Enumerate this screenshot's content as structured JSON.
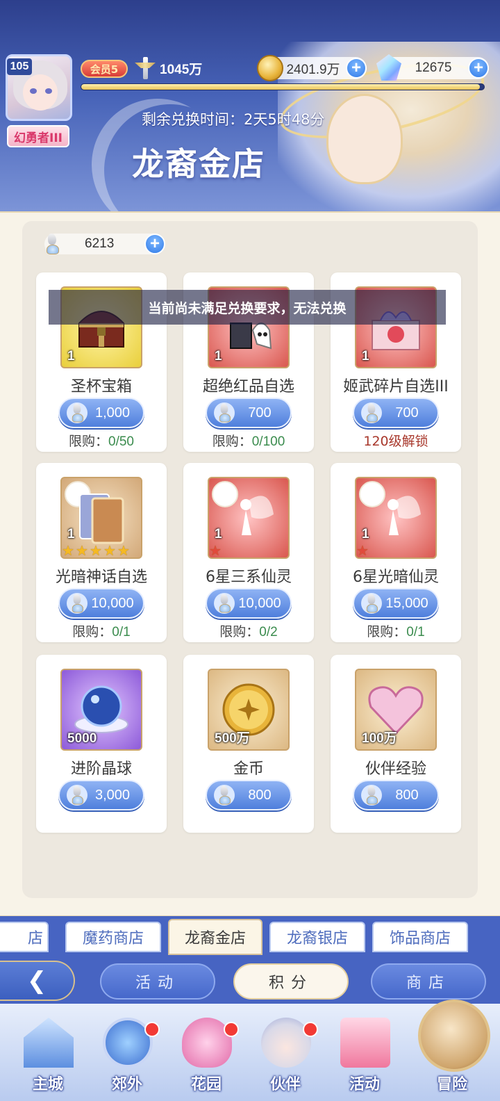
{
  "header": {
    "level": "105",
    "player_title": "幻勇者III",
    "vip": "会员5",
    "power": "1045万",
    "gold": "2401.9万",
    "gems": "12675",
    "exp_fraction": 0.99,
    "countdown": "剩余兑换时间：2天5时48分",
    "shop_title": "龙裔金店"
  },
  "currency": {
    "amount": "6213"
  },
  "toast": "当前尚未满足兑换要求，无法兑换",
  "items": [
    {
      "name": "圣杯宝箱",
      "qty": "1",
      "price": "1,000",
      "limit_label": "限购：",
      "limit_value": "0/50"
    },
    {
      "name": "超绝红品自选",
      "qty": "1",
      "price": "700",
      "limit_label": "限购：",
      "limit_value": "0/100"
    },
    {
      "name": "姬武碎片自选III",
      "qty": "1",
      "price": "700",
      "lock_text": "120级解锁"
    },
    {
      "name": "光暗神话自选",
      "qty": "1",
      "price": "10,000",
      "limit_label": "限购：",
      "limit_value": "0/1",
      "stars": 5
    },
    {
      "name": "6星三系仙灵",
      "qty": "1",
      "price": "10,000",
      "limit_label": "限购：",
      "limit_value": "0/2",
      "stars": 1
    },
    {
      "name": "6星光暗仙灵",
      "qty": "1",
      "price": "15,000",
      "limit_label": "限购：",
      "limit_value": "0/1",
      "stars": 1
    },
    {
      "name": "进阶晶球",
      "qty": "5000",
      "price": "3,000"
    },
    {
      "name": "金币",
      "qty": "500万",
      "price": "800"
    },
    {
      "name": "伙伴经验",
      "qty": "100万",
      "price": "800"
    }
  ],
  "shop_tabs": [
    "店",
    "魔药商店",
    "龙裔金店",
    "龙裔银店",
    "饰品商店"
  ],
  "nav_buttons": [
    "活动",
    "积分",
    "商店"
  ],
  "bottom_nav": [
    "主城",
    "郊外",
    "花园",
    "伙伴",
    "活动",
    "冒险"
  ],
  "colors": {
    "accent": "#4f7fdc",
    "limit_green": "#3b8c4e",
    "lock_red": "#a8382c"
  }
}
